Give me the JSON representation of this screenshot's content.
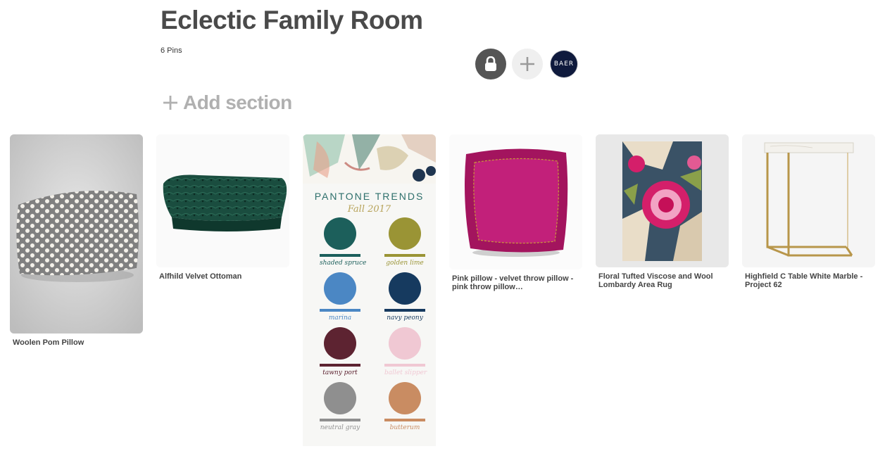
{
  "board": {
    "title": "Eclectic Family Room",
    "pin_count": "6 Pins",
    "avatar_text": "BAER",
    "add_section_label": "Add section"
  },
  "icons": {
    "lock": "lock-icon",
    "plus": "plus-icon",
    "add_section": "plus-icon"
  },
  "pantone": {
    "title": "PANTONE TRENDS",
    "subtitle": "Fall 2017",
    "swatches": [
      {
        "color": "#1c5f5b",
        "name": "shaded spruce"
      },
      {
        "color": "#9a9435",
        "name": "golden lime"
      },
      {
        "color": "#4b87c4",
        "name": "marina"
      },
      {
        "color": "#163a5f",
        "name": "navy peony"
      },
      {
        "color": "#5d2331",
        "name": "tawny port"
      },
      {
        "color": "#f0c8d3",
        "name": "ballet slipper"
      },
      {
        "color": "#8f8f8f",
        "name": "neutral gray"
      },
      {
        "color": "#c98c62",
        "name": "butterum"
      }
    ]
  },
  "pins": [
    {
      "caption": "Woolen Pom Pillow"
    },
    {
      "caption": "Alfhild Velvet Ottoman"
    },
    {
      "caption": ""
    },
    {
      "caption": "Pink pillow - velvet throw pillow - pink throw pillow…"
    },
    {
      "caption": "Floral Tufted Viscose and Wool Lombardy Area Rug"
    },
    {
      "caption": "Highfield C Table White Marble - Project 62"
    }
  ]
}
